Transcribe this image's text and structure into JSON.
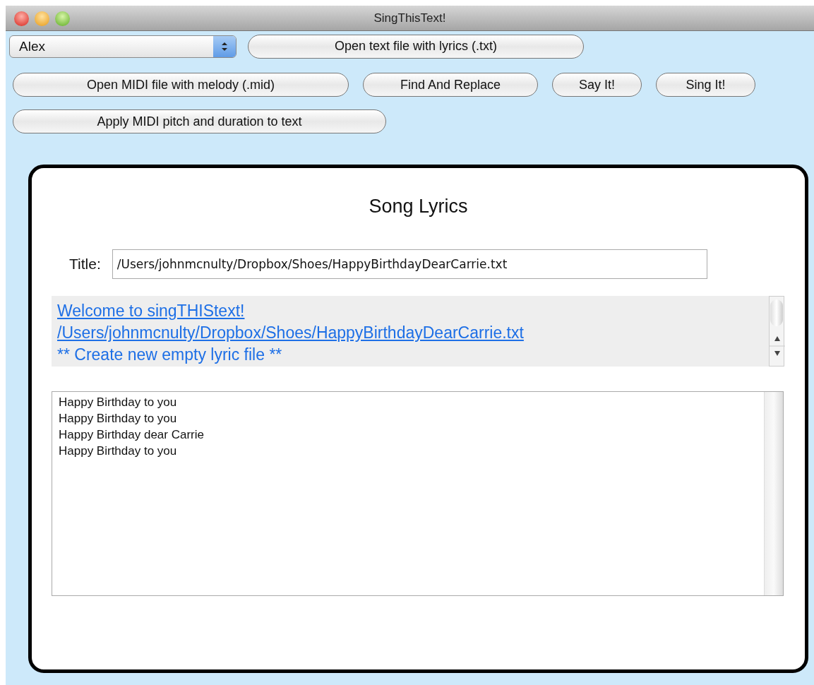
{
  "window": {
    "title": "SingThisText!"
  },
  "voice_dropdown": {
    "value": "Alex"
  },
  "button_rows": [
    [
      "Open text file with lyrics (.txt)"
    ],
    [
      "Open MIDI file with melody (.mid)",
      "Find And Replace",
      "Say It!",
      "Sing It!"
    ],
    [
      "Apply MIDI pitch and duration to text"
    ]
  ],
  "panel": {
    "heading": "Song Lyrics",
    "title_label": "Title:",
    "title_value": "/Users/johnmcnulty/Dropbox/Shoes/HappyBirthdayDearCarrie.txt",
    "file_list": [
      {
        "label": "Welcome to singTHIStext!",
        "kind": "link"
      },
      {
        "label": "/Users/johnmcnulty/Dropbox/Shoes/HappyBirthdayDearCarrie.txt",
        "kind": "link"
      },
      {
        "label": "** Create new empty lyric file **",
        "kind": "action"
      }
    ],
    "lyrics": [
      "Happy Birthday to you",
      "Happy Birthday to you",
      "Happy Birthday dear Carrie",
      "Happy Birthday to you"
    ]
  }
}
